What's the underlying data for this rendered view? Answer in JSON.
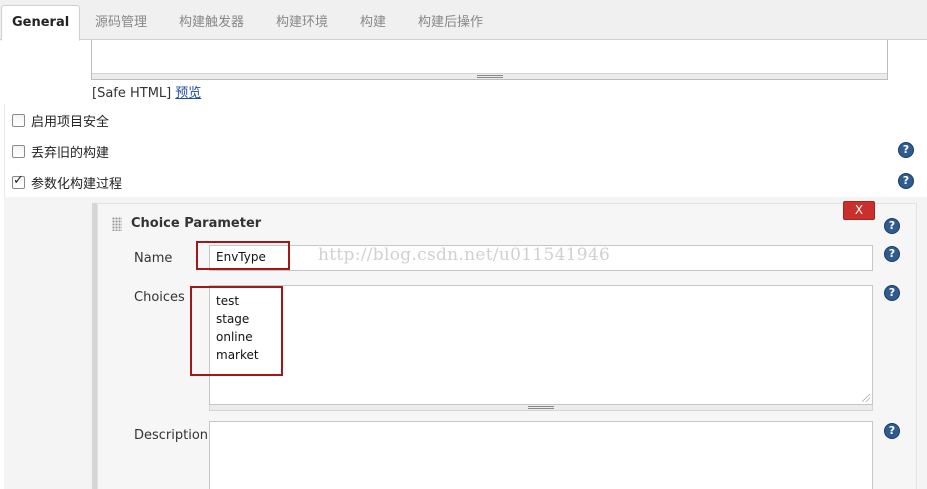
{
  "tabs": [
    {
      "label": "General"
    },
    {
      "label": "源码管理"
    },
    {
      "label": "构建触发器"
    },
    {
      "label": "构建环境"
    },
    {
      "label": "构建"
    },
    {
      "label": "构建后操作"
    }
  ],
  "description": {
    "safe_html_label": "[Safe HTML]",
    "preview_link": "预览"
  },
  "options": [
    {
      "label": "启用项目安全",
      "checked": false
    },
    {
      "label": "丢弃旧的构建",
      "checked": false
    },
    {
      "label": "参数化构建过程",
      "checked": true
    }
  ],
  "parameter": {
    "title": "Choice Parameter",
    "delete_label": "X",
    "name_label": "Name",
    "name_value": "EnvType",
    "choices_label": "Choices",
    "choices": [
      "test",
      "stage",
      "online",
      "market"
    ],
    "description_label": "Description",
    "description_value": ""
  },
  "help_icon_text": "?",
  "watermark": "http://blog.csdn.net/u011541946",
  "colors": {
    "delete_button": "#c9302c",
    "help_icon": "#2f5b8e",
    "link": "#1f4da8",
    "highlight_box": "#a21717"
  }
}
